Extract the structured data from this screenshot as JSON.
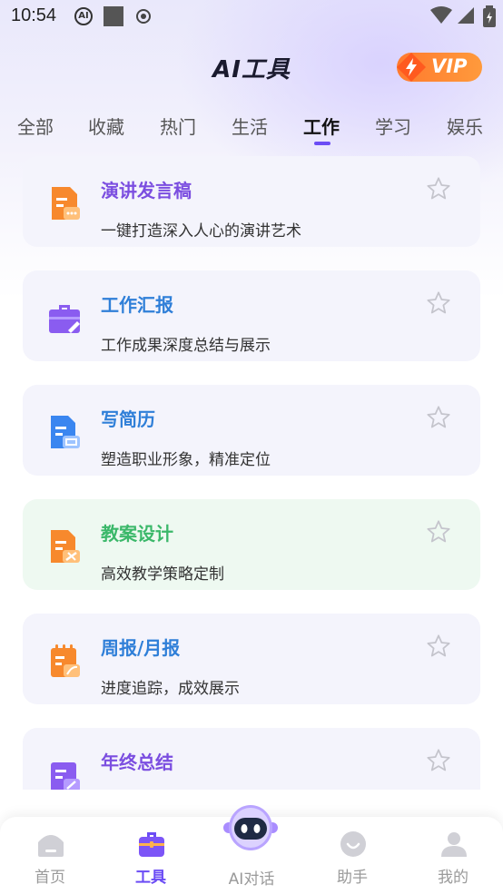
{
  "status_bar": {
    "time": "10:54",
    "ai_indicator": "AI"
  },
  "header": {
    "title": "AI工具",
    "vip_label": "VIP"
  },
  "tabs": [
    {
      "label": "全部"
    },
    {
      "label": "收藏"
    },
    {
      "label": "热门"
    },
    {
      "label": "生活"
    },
    {
      "label": "工作",
      "active": true
    },
    {
      "label": "学习"
    },
    {
      "label": "娱乐"
    }
  ],
  "cards": [
    {
      "title": "演讲发言稿",
      "desc": "一键打造深入人心的演讲艺术",
      "title_color": "#7b4ee0",
      "icon": "speech-doc-icon"
    },
    {
      "title": "工作汇报",
      "desc": "工作成果深度总结与展示",
      "title_color": "#2f7fd8",
      "icon": "briefcase-icon"
    },
    {
      "title": "写简历",
      "desc": "塑造职业形象，精准定位",
      "title_color": "#2f7fd8",
      "icon": "resume-doc-icon"
    },
    {
      "title": "教案设计",
      "desc": "高效教学策略定制",
      "title_color": "#3bb86a",
      "icon": "lesson-plan-icon"
    },
    {
      "title": "周报/月报",
      "desc": "进度追踪，成效展示",
      "title_color": "#2f7fd8",
      "icon": "report-notebook-icon"
    },
    {
      "title": "年终总结",
      "desc": "",
      "title_color": "#7b4ee0",
      "icon": "annual-summary-icon"
    }
  ],
  "bottom_nav": [
    {
      "label": "首页",
      "icon": "home-icon"
    },
    {
      "label": "工具",
      "icon": "toolbox-icon",
      "active": true
    },
    {
      "label": "AI对话",
      "icon": "robot-icon"
    },
    {
      "label": "助手",
      "icon": "assistant-icon"
    },
    {
      "label": "我的",
      "icon": "profile-icon"
    }
  ],
  "colors": {
    "accent": "#6b4cf5",
    "vip_orange": "#ff7a2e",
    "inactive_gray": "#9a9a9a"
  }
}
